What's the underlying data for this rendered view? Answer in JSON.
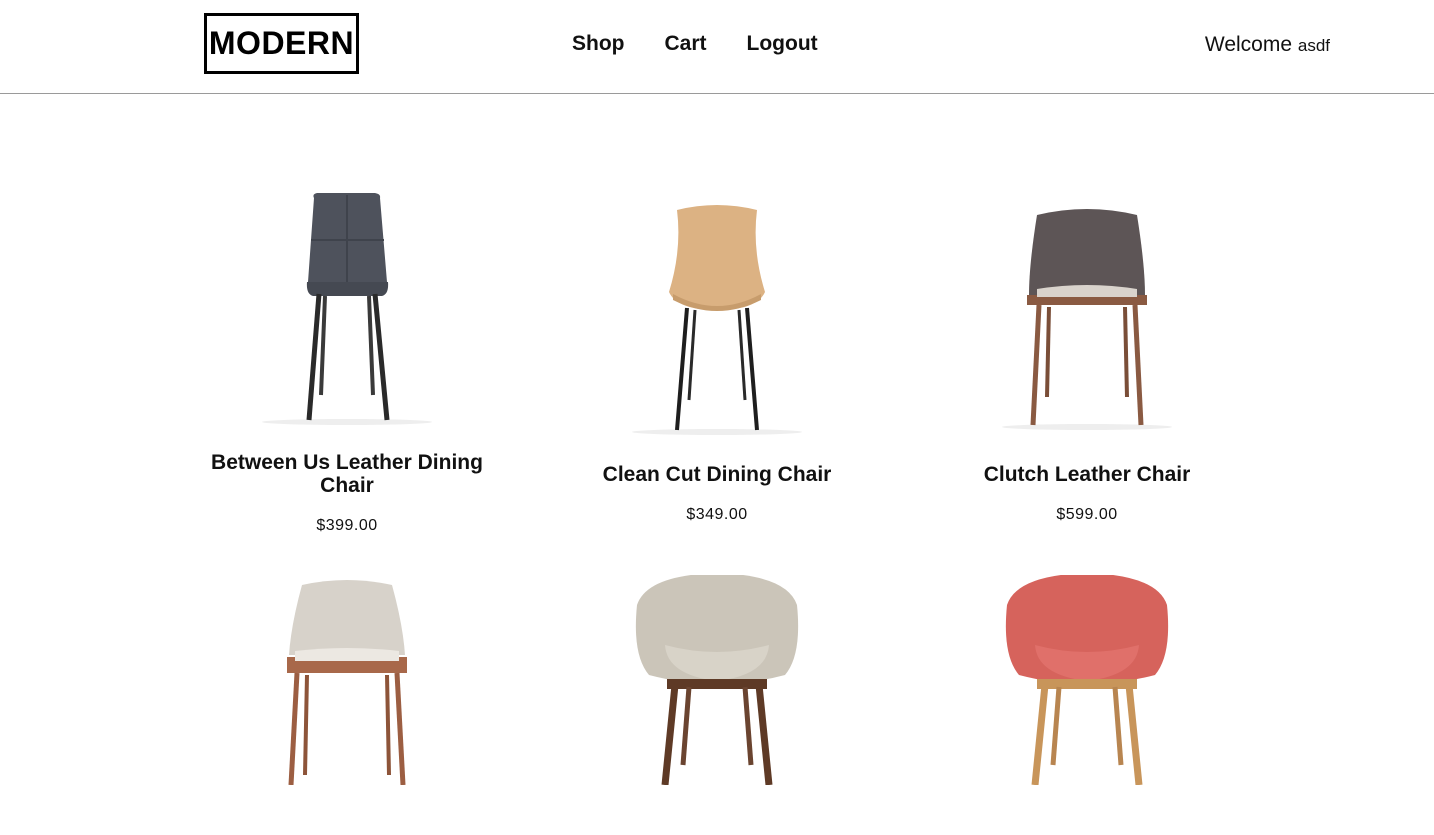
{
  "header": {
    "logo": "MODERN",
    "nav": [
      "Shop",
      "Cart",
      "Logout"
    ],
    "welcome_label": "Welcome",
    "username": "asdf"
  },
  "products": [
    {
      "name": "Between Us Leather Dining Chair",
      "price": "$399.00",
      "icon": "dining-chair-grey-icon",
      "color": "#4e525c"
    },
    {
      "name": "Clean Cut Dining Chair",
      "price": "$349.00",
      "icon": "dining-chair-wood-icon",
      "color": "#dcb283"
    },
    {
      "name": "Clutch Leather Chair",
      "price": "$599.00",
      "icon": "leather-chair-icon",
      "color": "#5d5556"
    },
    {
      "name": "",
      "price": "",
      "icon": "lounge-chair-grey-icon",
      "color": "#d7d2ca"
    },
    {
      "name": "",
      "price": "",
      "icon": "armchair-fabric-icon",
      "color": "#cbc5b9"
    },
    {
      "name": "",
      "price": "",
      "icon": "armchair-coral-icon",
      "color": "#d6635c"
    }
  ]
}
